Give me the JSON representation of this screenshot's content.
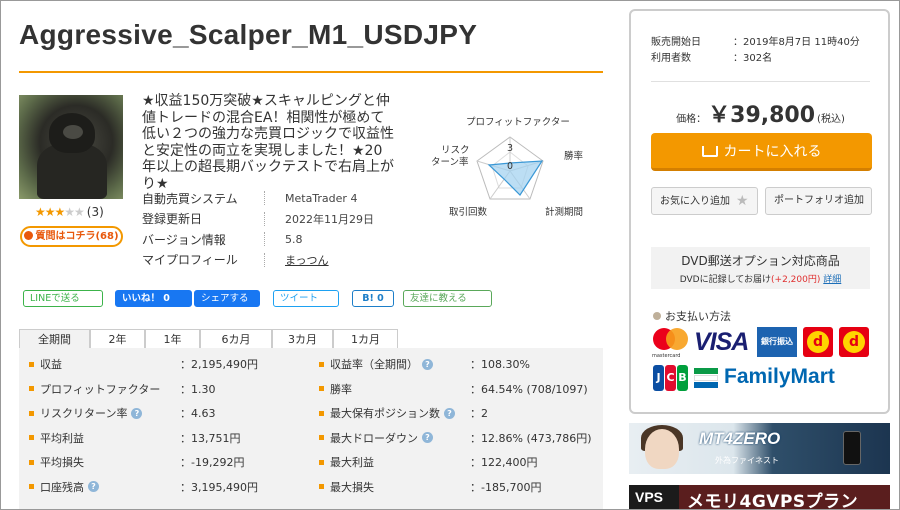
{
  "product": {
    "title": "Aggressive_Scalper_M1_USDJPY",
    "description": "★収益150万突破★スキャルピングと仲値トレードの混合EA！相関性が極めて低い２つの強力な売買ロジックで収益性と安定性の両立を実現しました！★20年以上の超長期バックテストで右肩上がり★",
    "rating_stars": 3,
    "rating_max": 5,
    "review_count": "(3)",
    "question_button": "質問はコチラ(68)"
  },
  "spec": [
    {
      "label": "自動売買システム",
      "value": "MetaTrader 4"
    },
    {
      "label": "登録更新日",
      "value": "2022年11月29日"
    },
    {
      "label": "バージョン情報",
      "value": "5.8"
    },
    {
      "label": "マイプロフィール",
      "value": "まっつん"
    }
  ],
  "radar": {
    "labels": [
      "プロフィットファクター",
      "勝率",
      "計測期間",
      "取引回数",
      "リスクリターン率"
    ],
    "label_risk_line1": "リスク",
    "label_risk_line2": "ターン率",
    "scale_outer": "3",
    "scale_center": "0"
  },
  "social": {
    "line": "LINEで送る",
    "fb_like": "いいね！ 0",
    "fb_share": "シェアする",
    "tweet": "ツイート",
    "hatena": "B! 0",
    "mail": "友達に教える"
  },
  "tabs": [
    "全期間",
    "2年",
    "1年",
    "6カ月",
    "3カ月",
    "1カ月"
  ],
  "stats_left": [
    {
      "label": "収益",
      "value": "：2,195,490円",
      "help": false
    },
    {
      "label": "プロフィットファクター",
      "value": "：1.30",
      "help": false
    },
    {
      "label": "リスクリターン率",
      "value": "：4.63",
      "help": true
    },
    {
      "label": "平均利益",
      "value": "：13,751円",
      "help": false
    },
    {
      "label": "平均損失",
      "value": "：-19,292円",
      "help": false
    },
    {
      "label": "口座残高",
      "value": "：3,195,490円",
      "help": true
    }
  ],
  "stats_right": [
    {
      "label": "収益率（全期間）",
      "value": "：108.30%",
      "help": true
    },
    {
      "label": "勝率",
      "value": "：64.54% (708/1097)",
      "help": false
    },
    {
      "label": "最大保有ポジション数",
      "value": "：2",
      "help": true
    },
    {
      "label": "最大ドローダウン",
      "value": "：12.86% (473,786円)",
      "help": true
    },
    {
      "label": "最大利益",
      "value": "：122,400円",
      "help": false
    },
    {
      "label": "最大損失",
      "value": "：-185,700円",
      "help": false
    }
  ],
  "purchase": {
    "sale_start_label": "販売開始日",
    "sale_start_value": "：2019年8月7日 11時40分",
    "users_label": "利用者数",
    "users_value": "：302名",
    "price_label": "価格：",
    "price_value": "￥39,800",
    "price_tax": "(税込)",
    "cart_button": "カートに入れる",
    "favorite_button": "お気に入り追加",
    "portfolio_button": "ポートフォリオ追加",
    "dvd_title": "DVD郵送オプション対応商品",
    "dvd_text": "DVDに記録してお届け",
    "dvd_price": "(+2,200円)",
    "dvd_link": "詳細",
    "payment_heading": "お支払い方法"
  },
  "payment_logos": {
    "mastercard": "mastercard",
    "visa": "VISA",
    "bank": "銀行振込",
    "familymart": "FamilyMart",
    "jcb_letters": [
      "J",
      "C",
      "B"
    ]
  },
  "ads": {
    "ad1_title": "MT4ZERO",
    "ad1_sub": "外為ファイネスト",
    "ad2_vps": "VPS",
    "ad2_title": "メモリ4GVPSプラン"
  },
  "colors": {
    "accent": "#f39800",
    "facebook": "#1877f2",
    "twitter": "#1da1f2",
    "line": "#3cb34a"
  }
}
